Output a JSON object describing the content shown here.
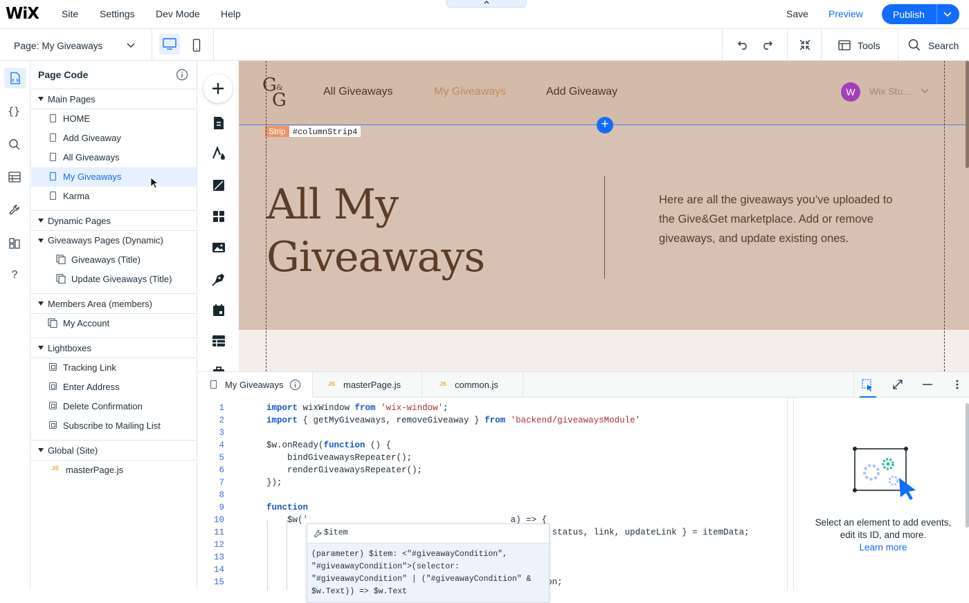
{
  "topbar": {
    "logo": "WiX",
    "menu": [
      "Site",
      "Settings",
      "Dev Mode",
      "Help"
    ],
    "save": "Save",
    "preview": "Preview",
    "publish": "Publish"
  },
  "secondbar": {
    "page_prefix": "Page:",
    "page_name": "My Giveaways",
    "tools": "Tools",
    "search": "Search"
  },
  "panel": {
    "title": "Page Code",
    "sections": [
      {
        "title": "Main Pages",
        "items": [
          "HOME",
          "Add Giveaway",
          "All Giveaways",
          "My Giveaways",
          "Karma"
        ]
      },
      {
        "title": "Dynamic Pages",
        "subtitle": "Giveaways Pages (Dynamic)",
        "items": [
          "Giveaways (Title)",
          "Update Giveaways (Title)"
        ]
      },
      {
        "title": "Members Area (members)",
        "items": [
          "My Account"
        ]
      },
      {
        "title": "Lightboxes",
        "items": [
          "Tracking Link",
          "Enter Address",
          "Delete Confirmation",
          "Subscribe to Mailing List"
        ]
      },
      {
        "title": "Global (Site)",
        "items": [
          "masterPage.js"
        ]
      }
    ],
    "selected_item": "My Giveaways"
  },
  "canvas": {
    "logo_g1": "G",
    "logo_amp": "&",
    "logo_g2": "G",
    "nav": [
      "All Giveaways",
      "My Giveaways",
      "Add Giveaway"
    ],
    "active_nav": "My Giveaways",
    "account_initial": "W",
    "account_name": "Wix Stu...",
    "strip_tag": "Strip",
    "strip_id": "#columnStrip4",
    "hero_title_line1": "All My",
    "hero_title_line2": "Giveaways",
    "hero_description": "Here are all the giveaways you’ve uploaded to the Give&Get marketplace. Add or remove giveaways, and update existing ones.",
    "colors": {
      "hero_bg": "#d7c1b3",
      "accent_text": "#c08a5a",
      "title_text": "#5a3c27"
    }
  },
  "code_panel": {
    "tabs": [
      "My Giveaways",
      "masterPage.js",
      "common.js"
    ],
    "active_tab": "My Giveaways",
    "line_numbers": [
      "1",
      "2",
      "3",
      "4",
      "5",
      "6",
      "7",
      "8",
      "9",
      "10",
      "11",
      "12",
      "13",
      "14",
      "15"
    ],
    "tooltip_header": "$item",
    "tooltip_body": "(parameter) $item: <\"#giveawayCondition\",\n\"#giveawayCondition\">(selector:\n\"#giveawayCondition\" | (\"#giveawayCondition\" &\n$w.Text)) => $w.Text",
    "props_message_line1": "Select an element to add events,",
    "props_message_line2": "edit its ID, and more.",
    "props_link": "Learn more"
  },
  "colors": {
    "brand": "#116dff",
    "border": "#dfe5eb"
  }
}
